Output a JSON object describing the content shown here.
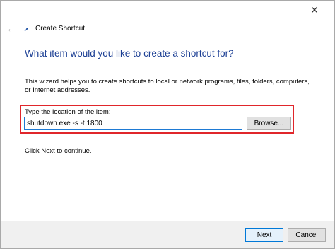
{
  "window": {
    "title": "Create Shortcut",
    "close_glyph": "✕",
    "back_glyph": "←"
  },
  "main": {
    "heading": "What item would you like to create a shortcut for?",
    "description": "This wizard helps you to create shortcuts to local or network programs, files, folders, computers, or Internet addresses.",
    "location_label_first": "T",
    "location_label_rest": "ype the location of the item:",
    "location_value": "shutdown.exe -s -t 1800",
    "browse_label_prefix": "Browse",
    "browse_label_suffix": "...",
    "browse_label_underline": "",
    "continue_text": "Click Next to continue."
  },
  "footer": {
    "next_underline": "N",
    "next_rest": "ext",
    "cancel_label": "Cancel"
  },
  "colors": {
    "heading": "#1c3f94",
    "highlight_box": "#e0262b",
    "input_border": "#1e7ad4",
    "primary_button_border": "#0078d7"
  },
  "icons": {
    "back": "back-arrow-icon",
    "close": "close-icon",
    "shortcut": "shortcut-icon"
  }
}
